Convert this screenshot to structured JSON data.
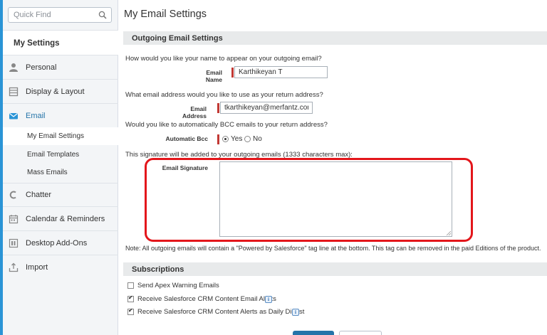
{
  "sidebar": {
    "search": {
      "placeholder": "Quick Find",
      "value": ""
    },
    "heading": "My Settings",
    "items": [
      {
        "label": "Personal",
        "icon": "person-icon"
      },
      {
        "label": "Display & Layout",
        "icon": "layout-icon"
      },
      {
        "label": "Email",
        "icon": "envelope-icon",
        "active": true
      },
      {
        "label": "Chatter",
        "icon": "chatter-icon"
      },
      {
        "label": "Calendar & Reminders",
        "icon": "calendar-icon"
      },
      {
        "label": "Desktop Add-Ons",
        "icon": "desktop-icon"
      },
      {
        "label": "Import",
        "icon": "import-icon"
      }
    ],
    "email_subitems": [
      {
        "label": "My Email Settings",
        "selected": true
      },
      {
        "label": "Email Templates"
      },
      {
        "label": "Mass Emails"
      }
    ]
  },
  "main": {
    "title": "My Email Settings",
    "outgoing": {
      "header": "Outgoing Email Settings",
      "q_name": "How would you like your name to appear on your outgoing email?",
      "name_label": "Email Name",
      "name_value": "Karthikeyan T",
      "q_address": "What email address would you like to use as your return address?",
      "address_label": "Email Address",
      "address_value": "tkarthikeyan@merfantz.com",
      "q_bcc": "Would you like to automatically BCC emails to your return address?",
      "bcc_label": "Automatic Bcc",
      "bcc_yes": "Yes",
      "bcc_no": "No",
      "bcc_selected": "Yes",
      "q_signature": "This signature will be added to your outgoing emails (1333 characters max):",
      "signature_label": "Email Signature",
      "signature_value": "",
      "note": "Note: All outgoing emails will contain a \"Powered by Salesforce\" tag line at the bottom. This tag can be removed in the paid Editions of the product."
    },
    "subscriptions": {
      "header": "Subscriptions",
      "items": [
        {
          "label": "Send Apex Warning Emails",
          "checked": false,
          "info": false
        },
        {
          "label": "Receive Salesforce CRM Content Email Alerts",
          "checked": true,
          "info": true
        },
        {
          "label": "Receive Salesforce CRM Content Alerts as Daily Digest",
          "checked": true,
          "info": true
        }
      ]
    }
  },
  "colors": {
    "accent": "#2a94d6",
    "required": "#c23934",
    "highlight": "#e3161b",
    "save_button": "#2574a9"
  }
}
